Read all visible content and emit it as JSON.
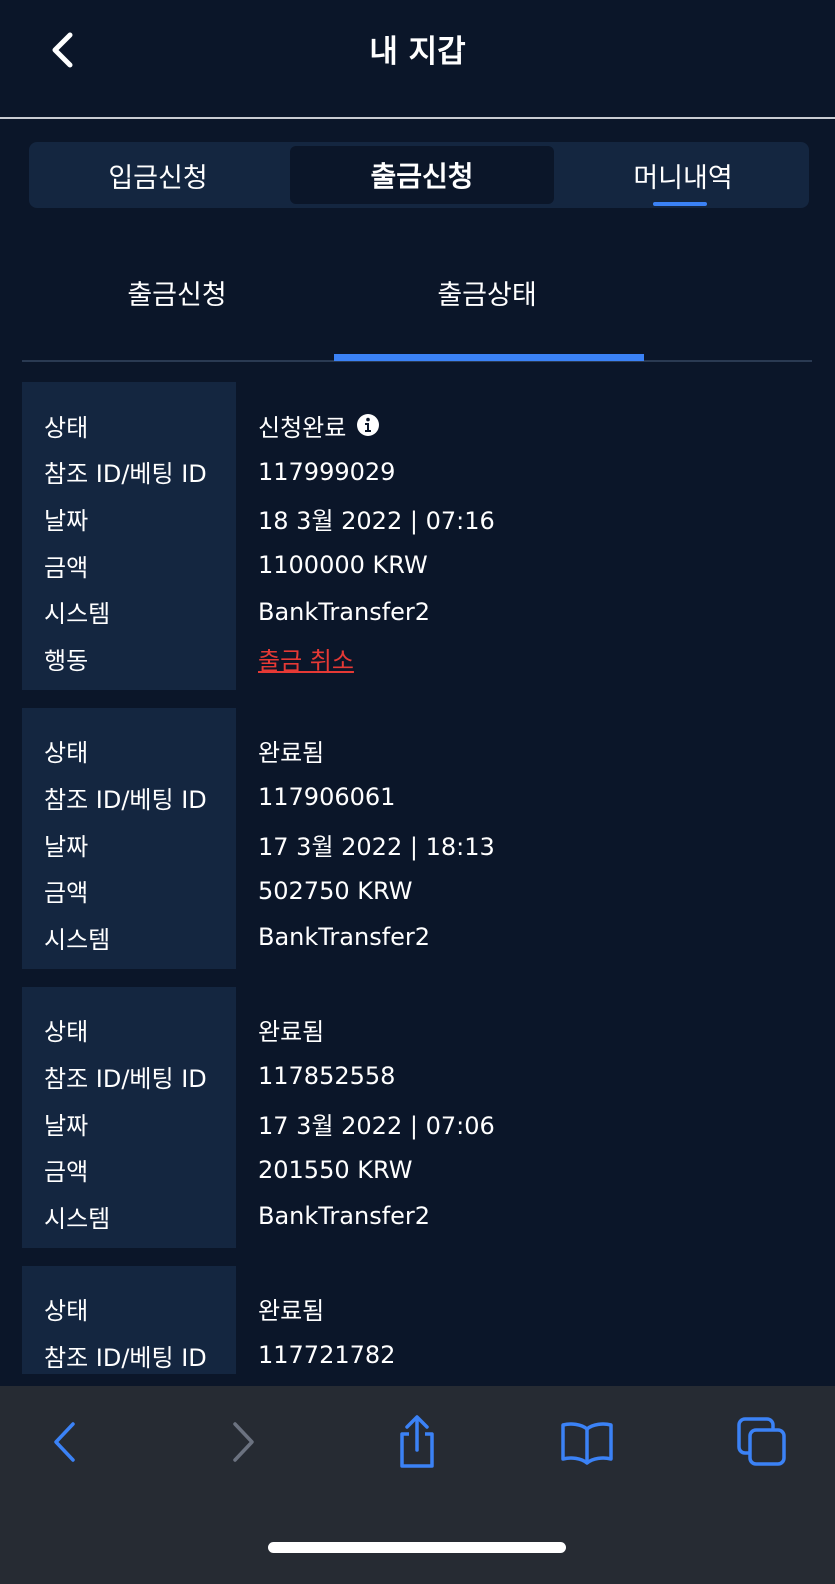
{
  "header": {
    "title": "내 지갑"
  },
  "top_tabs": [
    {
      "label": "입금신청"
    },
    {
      "label": "출금신청"
    },
    {
      "label": "머니내역"
    }
  ],
  "top_tab_active": "출금신청",
  "sub_tabs": [
    {
      "label": "출금신청"
    },
    {
      "label": "출금상태"
    }
  ],
  "sub_tab_active": "출금상태",
  "labels": {
    "status": "상태",
    "ref_id": "참조 ID/베팅 ID",
    "date": "날짜",
    "amount": "금액",
    "system": "시스템",
    "action": "행동"
  },
  "records": [
    {
      "status": "신청완료",
      "ref_id": "117999029",
      "date": "18 3월 2022 | 07:16",
      "amount": "1100000 KRW",
      "system": "BankTransfer2",
      "action": "출금 취소"
    },
    {
      "status": "완료됨",
      "ref_id": "117906061",
      "date": "17 3월 2022 | 18:13",
      "amount": "502750 KRW",
      "system": "BankTransfer2"
    },
    {
      "status": "완료됨",
      "ref_id": "117852558",
      "date": "17 3월 2022 | 07:06",
      "amount": "201550 KRW",
      "system": "BankTransfer2"
    },
    {
      "status": "완료됨",
      "ref_id": "117721782"
    }
  ],
  "colors": {
    "background": "#0b1629",
    "panel": "#142640",
    "accent": "#3b82f6",
    "cancel_link": "#e53935",
    "browser_bar": "#262b33",
    "browser_icon": "#3b82f6",
    "browser_icon_disabled": "#6b7280"
  },
  "icons": {
    "header_back": "chevron-left-icon",
    "info": "info-circle-icon",
    "browser_back": "chevron-left-icon",
    "browser_forward": "chevron-right-icon",
    "share": "share-icon",
    "bookmarks": "book-icon",
    "tabs": "tabs-icon"
  }
}
